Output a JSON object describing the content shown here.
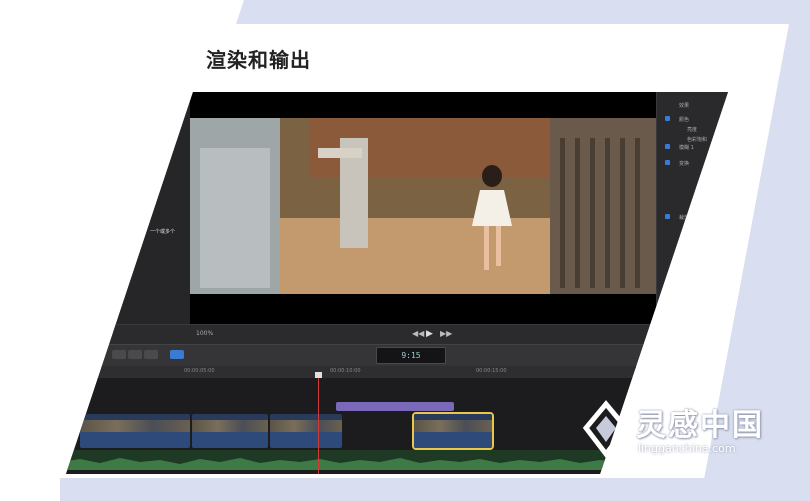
{
  "title": "渲染和输出",
  "browser": {
    "caption": "一个或多个"
  },
  "inspector": {
    "rows": [
      "效果",
      "颜色",
      "亮度",
      "色彩饱和",
      "模糊 1",
      "变换",
      "裁剪"
    ]
  },
  "viewer": {
    "zoom_label": "100%"
  },
  "toolbar": {
    "timecode": "9:15"
  },
  "ruler": {
    "marks": [
      "00:00:05:00",
      "00:00:10:00",
      "00:00:15:00"
    ]
  },
  "watermark": {
    "name": "灵感中国",
    "url": "lingganchina.com"
  },
  "colors": {
    "band": "#d9def0",
    "panel": "#1f1f21",
    "accent": "#3a7bd5",
    "playhead": "#d23a3a",
    "connected_clip": "#7a68b8"
  }
}
